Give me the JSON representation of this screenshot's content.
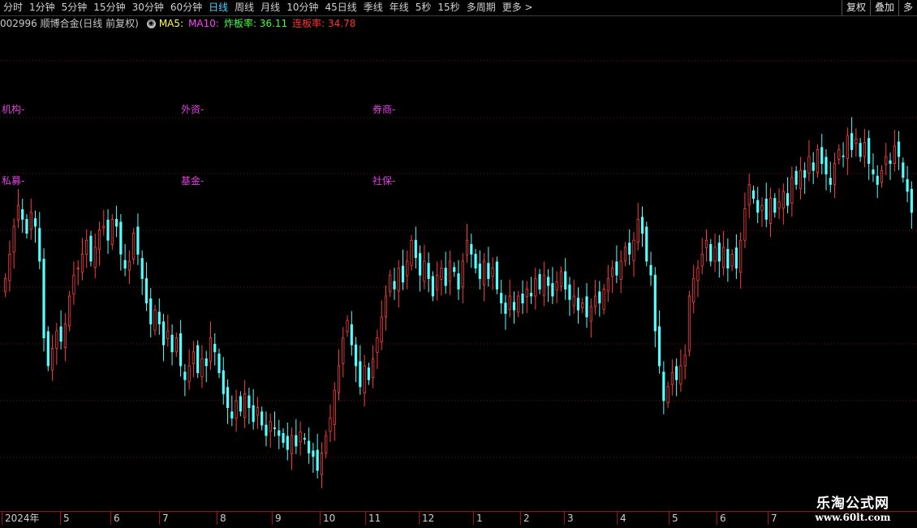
{
  "toolbar": {
    "tabs": [
      "分时",
      "1分钟",
      "5分钟",
      "15分钟",
      "30分钟",
      "60分钟",
      "日线",
      "周线",
      "月线",
      "10分钟",
      "45日线",
      "季线",
      "年线",
      "5秒",
      "15秒",
      "多周期",
      "更多 >"
    ],
    "active": "日线",
    "right": [
      "复权",
      "叠加",
      "多"
    ]
  },
  "info": {
    "stock": "002996 顺博合金(日线 前复权)",
    "ma5": "MA5:",
    "ma10": "MA10:",
    "zhaban_label": "炸板率:",
    "zhaban_value": "36.11",
    "lianban_label": "连板率:",
    "lianban_value": "34.78",
    "colors": {
      "ma5": "#ffff40",
      "ma10": "#ff40ff",
      "zhaban": "#40ff40",
      "lianban": "#ff3030"
    }
  },
  "overlay_labels": {
    "jigou": "机构-",
    "waizi": "外资-",
    "quanshang": "券商-",
    "simu": "私募-",
    "jijin": "基金-",
    "shebao": "社保-"
  },
  "xaxis": {
    "labels": [
      "2024年",
      "5",
      "6",
      "7",
      "8",
      "9",
      "10",
      "11",
      "12",
      "1",
      "2",
      "3",
      "4",
      "5",
      "6",
      "7"
    ]
  },
  "watermark": {
    "line1": "乐淘公式网",
    "line2": "www.60lt.com"
  },
  "chart_data": {
    "type": "candlestick",
    "up_color": "#ff3c3c",
    "down_color": "#54ffff",
    "grid": "dotted red horizontal",
    "candles_close": [
      0.55,
      0.62,
      0.7,
      0.76,
      0.72,
      0.68,
      0.74,
      0.7,
      0.6,
      0.38,
      0.3,
      0.35,
      0.4,
      0.37,
      0.42,
      0.5,
      0.56,
      0.58,
      0.62,
      0.66,
      0.6,
      0.64,
      0.69,
      0.7,
      0.66,
      0.72,
      0.7,
      0.62,
      0.58,
      0.6,
      0.68,
      0.62,
      0.55,
      0.48,
      0.42,
      0.46,
      0.42,
      0.36,
      0.4,
      0.34,
      0.38,
      0.3,
      0.26,
      0.3,
      0.34,
      0.28,
      0.32,
      0.3,
      0.38,
      0.34,
      0.28,
      0.22,
      0.18,
      0.15,
      0.2,
      0.17,
      0.22,
      0.18,
      0.14,
      0.18,
      0.13,
      0.1,
      0.14,
      0.12,
      0.1,
      0.08,
      0.06,
      0.1,
      0.07,
      0.11,
      0.09,
      0.05,
      0.04,
      0.0,
      0.05,
      0.1,
      0.15,
      0.23,
      0.3,
      0.38,
      0.43,
      0.36,
      0.3,
      0.24,
      0.3,
      0.26,
      0.32,
      0.38,
      0.44,
      0.5,
      0.56,
      0.52,
      0.58,
      0.54,
      0.6,
      0.66,
      0.61,
      0.56,
      0.6,
      0.55,
      0.5,
      0.56,
      0.58,
      0.53,
      0.6,
      0.57,
      0.52,
      0.6,
      0.66,
      0.62,
      0.58,
      0.55,
      0.6,
      0.55,
      0.58,
      0.52,
      0.48,
      0.45,
      0.5,
      0.46,
      0.5,
      0.48,
      0.52,
      0.5,
      0.55,
      0.52,
      0.56,
      0.53,
      0.5,
      0.54,
      0.57,
      0.52,
      0.49,
      0.5,
      0.46,
      0.48,
      0.44,
      0.47,
      0.5,
      0.48,
      0.52,
      0.55,
      0.58,
      0.56,
      0.6,
      0.64,
      0.62,
      0.66,
      0.72,
      0.68,
      0.6,
      0.56,
      0.4,
      0.3,
      0.2,
      0.24,
      0.28,
      0.26,
      0.3,
      0.33,
      0.5,
      0.55,
      0.58,
      0.62,
      0.66,
      0.6,
      0.64,
      0.6,
      0.64,
      0.58,
      0.62,
      0.58,
      0.66,
      0.75,
      0.82,
      0.78,
      0.74,
      0.76,
      0.72,
      0.78,
      0.74,
      0.77,
      0.8,
      0.76,
      0.84,
      0.82,
      0.86,
      0.84,
      0.9,
      0.86,
      0.92,
      0.88,
      0.85,
      0.82,
      0.88,
      0.92,
      0.9,
      0.96,
      0.92,
      0.95,
      0.9,
      0.94,
      0.88,
      0.85,
      0.82,
      0.86,
      0.9,
      0.88,
      0.93,
      0.9,
      0.84,
      0.8,
      0.74
    ]
  }
}
